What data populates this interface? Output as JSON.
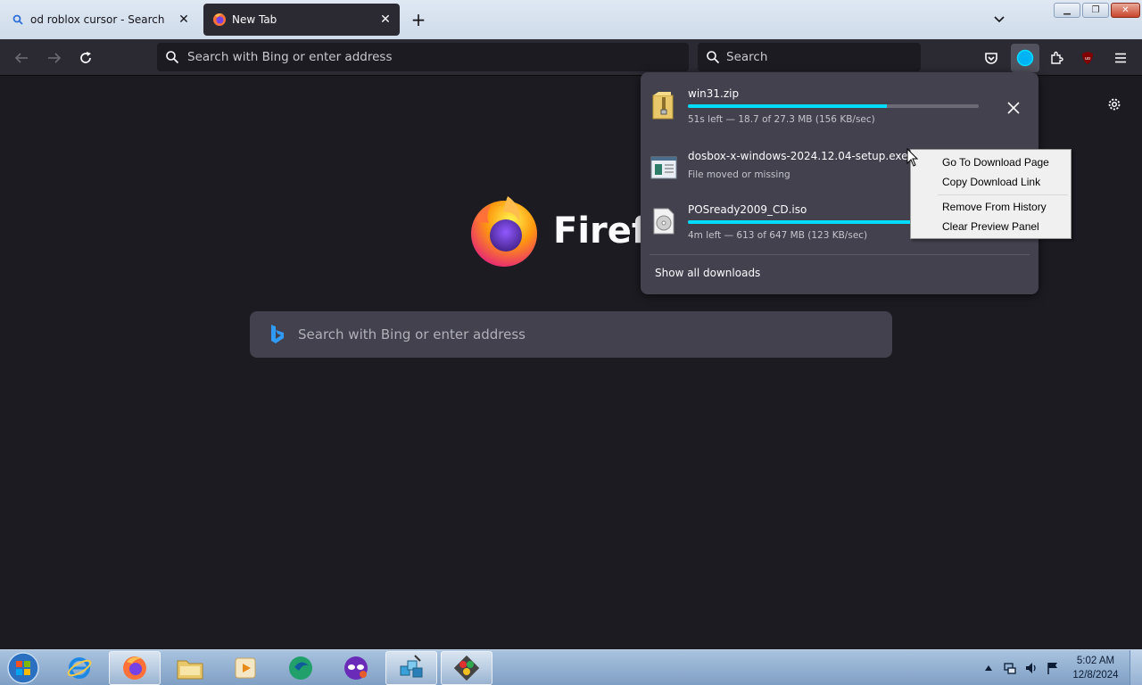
{
  "tabs": [
    {
      "title": "od roblox cursor - Search",
      "icon": "search-icon",
      "close": "✕"
    },
    {
      "title": "New Tab",
      "icon": "firefox-icon",
      "close": "✕"
    }
  ],
  "navbar": {
    "url_placeholder": "Search with Bing or enter address",
    "search_placeholder": "Search"
  },
  "newtab": {
    "wordmark": "Firefox",
    "search_placeholder": "Search with Bing or enter address"
  },
  "downloads": {
    "items": [
      {
        "name": "win31.zip",
        "status": "51s left — 18.7 of 27.3 MB (156 KB/sec)",
        "progress": 0.685,
        "icon": "zip-folder-icon"
      },
      {
        "name": "dosbox-x-windows-2024.12.04-setup.exe",
        "status": "File moved or missing",
        "progress": null,
        "icon": "installer-icon"
      },
      {
        "name": "POSready2009_CD.iso",
        "status": "4m left — 613 of 647 MB (123 KB/sec)",
        "progress": 0.947,
        "icon": "disc-image-icon"
      }
    ],
    "show_all": "Show all downloads"
  },
  "context_menu": {
    "items": [
      "Go To Download Page",
      "Copy Download Link",
      "Remove From History",
      "Clear Preview Panel"
    ]
  },
  "taskbar": {
    "apps": [
      "internet-explorer",
      "firefox",
      "file-explorer",
      "media-player",
      "app-green",
      "app-purple",
      "app-blocks",
      "app-tools"
    ],
    "clock_time": "5:02 AM",
    "clock_date": "12/8/2024"
  },
  "colors": {
    "accent": "#00ddff",
    "panel": "#42414d",
    "page_bg": "#1c1b22"
  }
}
